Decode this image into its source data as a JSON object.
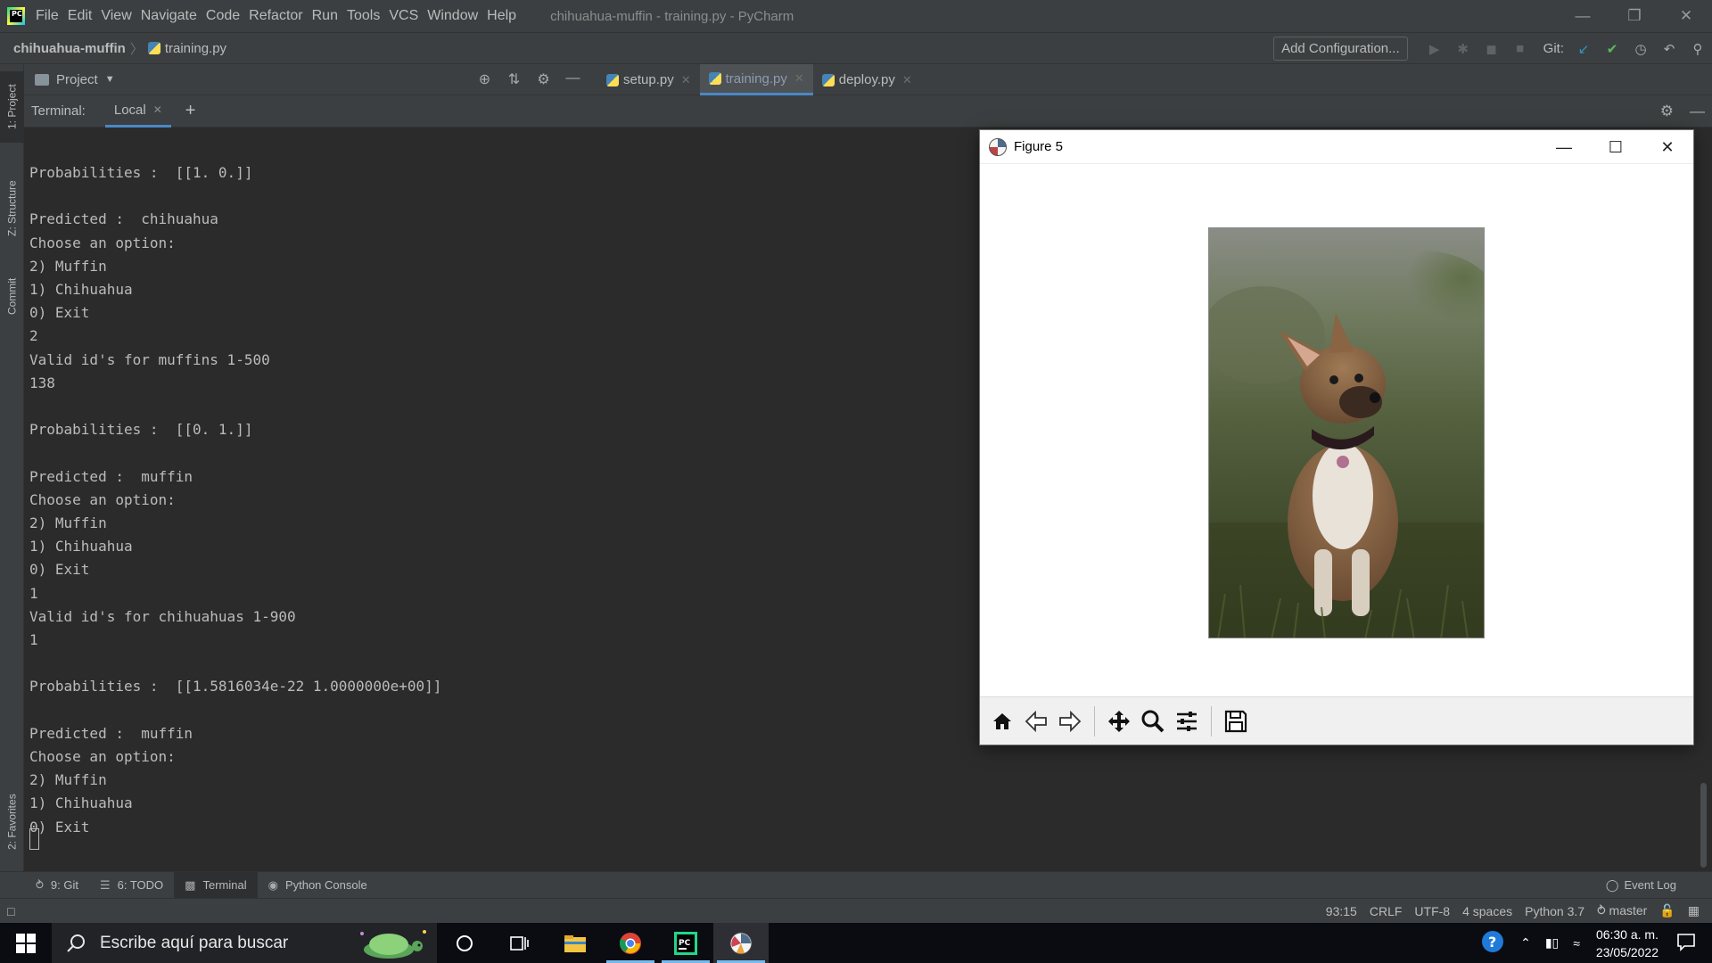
{
  "menu": {
    "items": [
      "File",
      "Edit",
      "View",
      "Navigate",
      "Code",
      "Refactor",
      "Run",
      "Tools",
      "VCS",
      "Window",
      "Help"
    ],
    "window_title": "chihuahua-muffin - training.py - PyCharm"
  },
  "nav": {
    "project": "chihuahua-muffin",
    "file": "training.py",
    "add_config": "Add Configuration...",
    "git_label": "Git:"
  },
  "stripe": {
    "project": "1: Project",
    "structure": "Z: Structure",
    "commit": "Commit",
    "favorites": "2: Favorites"
  },
  "project_panel": {
    "label": "Project"
  },
  "editor_tabs": [
    {
      "label": "setup.py"
    },
    {
      "label": "training.py"
    },
    {
      "label": "deploy.py"
    }
  ],
  "terminal": {
    "label": "Terminal:",
    "tab": "Local",
    "lines": [
      "Probabilities :  [[1. 0.]]",
      "",
      "Predicted :  chihuahua",
      "Choose an option:",
      "2) Muffin",
      "1) Chihuahua",
      "0) Exit",
      "2",
      "Valid id's for muffins 1-500",
      "138",
      "",
      "Probabilities :  [[0. 1.]]",
      "",
      "Predicted :  muffin",
      "Choose an option:",
      "2) Muffin",
      "1) Chihuahua",
      "0) Exit",
      "1",
      "Valid id's for chihuahuas 1-900",
      "1",
      "",
      "Probabilities :  [[1.5816034e-22 1.0000000e+00]]",
      "",
      "Predicted :  muffin",
      "Choose an option:",
      "2) Muffin",
      "1) Chihuahua",
      "0) Exit"
    ]
  },
  "figure": {
    "title": "Figure 5"
  },
  "bottom_tabs": [
    {
      "label": "9: Git"
    },
    {
      "label": "6: TODO"
    },
    {
      "label": "Terminal"
    },
    {
      "label": "Python Console"
    }
  ],
  "event_log": "Event Log",
  "status": {
    "position": "93:15",
    "line_sep": "CRLF",
    "encoding": "UTF-8",
    "indent": "4 spaces",
    "interpreter": "Python 3.7",
    "branch": "master"
  },
  "taskbar": {
    "search_placeholder": "Escribe aquí para buscar",
    "time": "06:30 a. m.",
    "date": "23/05/2022"
  },
  "colors": {
    "ide_bg": "#2b2b2b",
    "panel_bg": "#3c3f41",
    "accent_blue": "#4a88c7",
    "git_green": "#5fb760"
  }
}
